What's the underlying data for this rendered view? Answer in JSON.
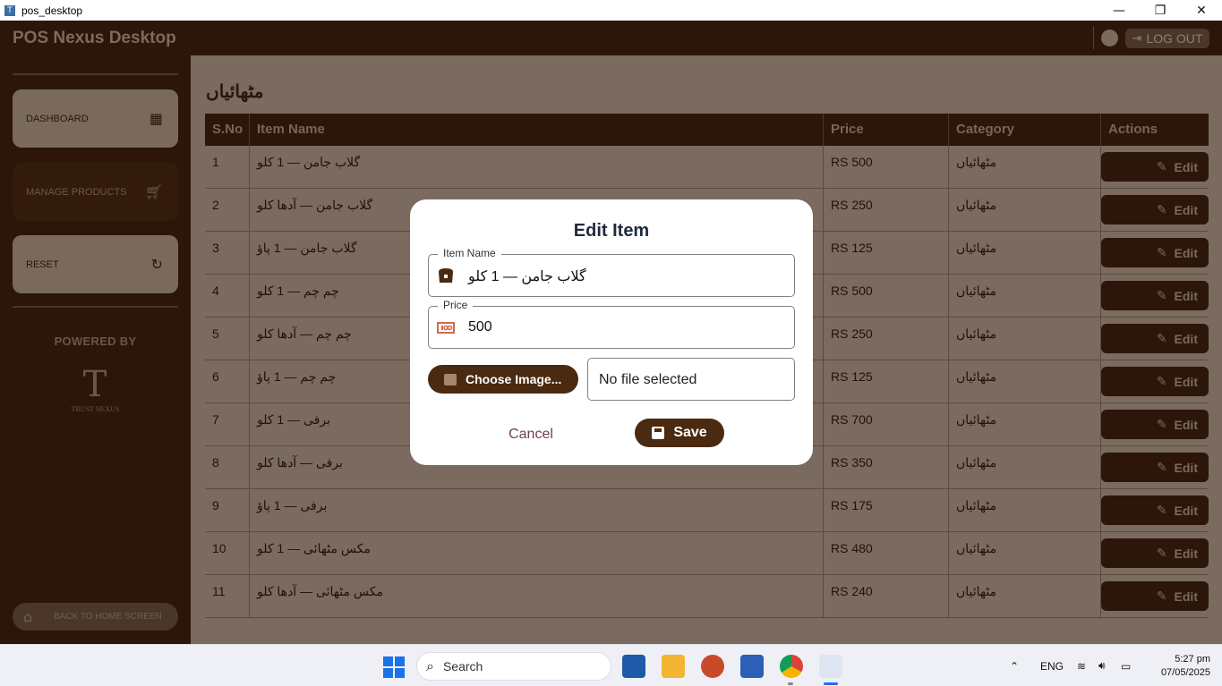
{
  "window": {
    "title": "pos_desktop",
    "min": "—",
    "max": "❐",
    "close": "✕"
  },
  "header": {
    "brand": "POS Nexus Desktop",
    "logout_label": "LOG OUT"
  },
  "sidebar": {
    "dashboard_label": "DASHBOARD",
    "manage_label": "MANAGE PRODUCTS",
    "reset_label": "RESET",
    "powered_by": "POWERED BY",
    "logo_text": "TRUST NEXUS",
    "home_label": "BACK TO HOME SCREEN"
  },
  "page": {
    "title": "مٹھائیاں"
  },
  "table": {
    "headers": {
      "sno": "S.No",
      "name": "Item Name",
      "price": "Price",
      "category": "Category",
      "actions": "Actions"
    },
    "edit_label": "Edit",
    "rows": [
      {
        "sno": "1",
        "name": "گلاب جامن — 1 کلو",
        "price": "RS 500",
        "category": "مٹھائیاں"
      },
      {
        "sno": "2",
        "name": "گلاب جامن — آدھا کلو",
        "price": "RS 250",
        "category": "مٹھائیاں"
      },
      {
        "sno": "3",
        "name": "گلاب جامن — 1 پاؤ",
        "price": "RS 125",
        "category": "مٹھائیاں"
      },
      {
        "sno": "4",
        "name": "چم چم — 1 کلو",
        "price": "RS 500",
        "category": "مٹھائیاں"
      },
      {
        "sno": "5",
        "name": "چم چم — آدھا کلو",
        "price": "RS 250",
        "category": "مٹھائیاں"
      },
      {
        "sno": "6",
        "name": "چم چم — 1 پاؤ",
        "price": "RS 125",
        "category": "مٹھائیاں"
      },
      {
        "sno": "7",
        "name": "برفی — 1 کلو",
        "price": "RS 700",
        "category": "مٹھائیاں"
      },
      {
        "sno": "8",
        "name": "برفی — آدھا کلو",
        "price": "RS 350",
        "category": "مٹھائیاں"
      },
      {
        "sno": "9",
        "name": "برفی — 1 پاؤ",
        "price": "RS 175",
        "category": "مٹھائیاں"
      },
      {
        "sno": "10",
        "name": "مکس مٹھائی — 1 کلو",
        "price": "RS 480",
        "category": "مٹھائیاں"
      },
      {
        "sno": "11",
        "name": "مکس مٹھائی — آدھا کلو",
        "price": "RS 240",
        "category": "مٹھائیاں"
      }
    ]
  },
  "modal": {
    "title": "Edit Item",
    "name_label": "Item Name",
    "name_value": "گلاب جامن — 1 کلو",
    "price_label": "Price",
    "price_value": "500",
    "choose_label": "Choose Image...",
    "file_status": "No file selected",
    "cancel_label": "Cancel",
    "save_label": "Save"
  },
  "taskbar": {
    "search_placeholder": "Search",
    "lang": "ENG",
    "time": "5:27 pm",
    "date": "07/05/2025"
  },
  "colors": {
    "brand_dark": "#2b1609",
    "accent": "#4a2a10",
    "overlay_content": "#7b6a5f"
  }
}
